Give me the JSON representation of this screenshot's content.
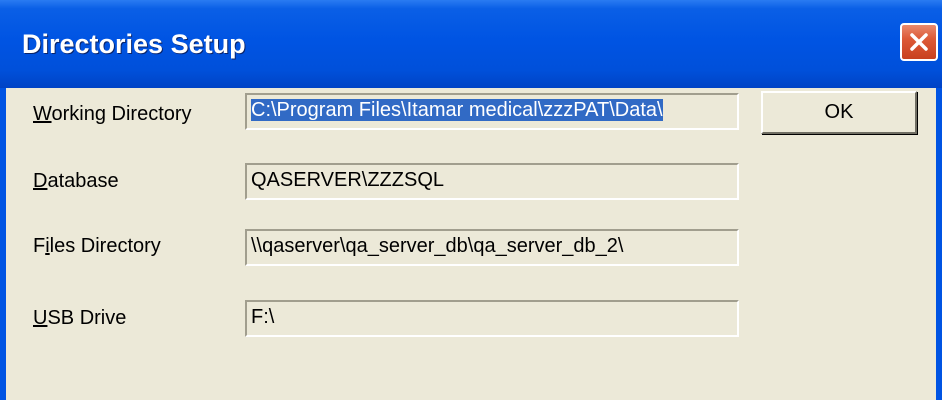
{
  "window": {
    "title": "Directories Setup",
    "close_icon": "close-icon"
  },
  "fields": [
    {
      "mnemonic": "W",
      "label_rest": "orking Directory",
      "value": "C:\\Program Files\\Itamar medical\\zzzPAT\\Data\\",
      "selected": true
    },
    {
      "mnemonic": "D",
      "label_rest": "atabase",
      "value": "QASERVER\\ZZZSQL",
      "selected": false
    },
    {
      "mnemonic": "i",
      "label_pre": "F",
      "label_rest": "les Directory",
      "value": "\\\\qaserver\\qa_server_db\\qa_server_db_2\\",
      "selected": false
    },
    {
      "mnemonic": "U",
      "label_rest": "SB Drive",
      "value": "F:\\",
      "selected": false
    }
  ],
  "buttons": {
    "ok_label": "OK"
  },
  "colors": {
    "titlebar": "#0054e3",
    "face": "#ece9d8",
    "selection": "#316ac5",
    "close": "#dd5a37"
  }
}
